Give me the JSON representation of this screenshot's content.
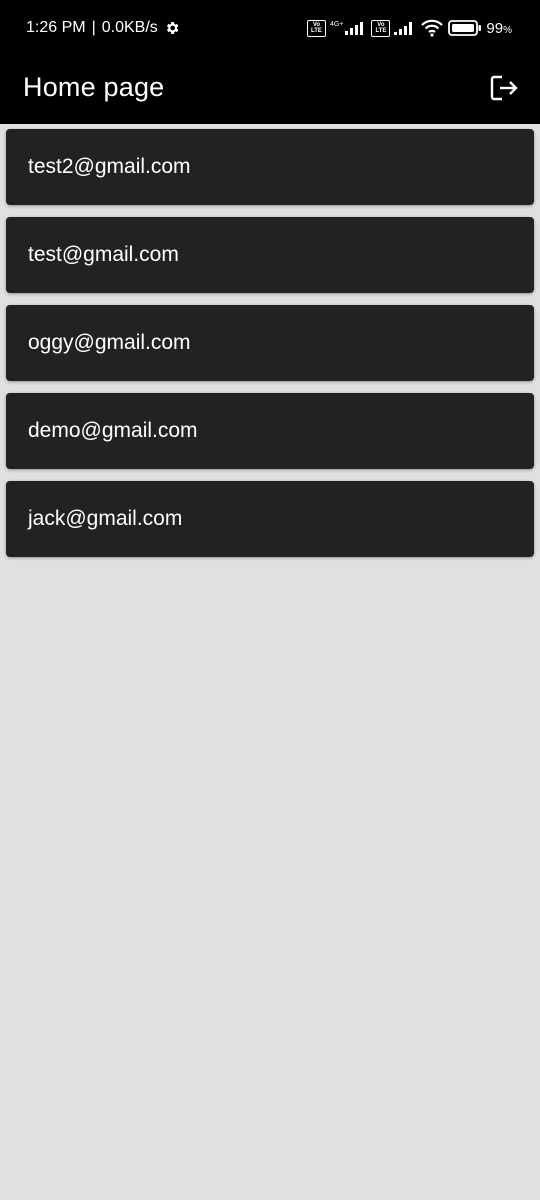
{
  "status_bar": {
    "time": "1:26 PM",
    "separator": "|",
    "net_speed": "0.0KB/s",
    "network_type": "4G+",
    "volte_label_top": "Vo",
    "volte_label_bottom": "LTE",
    "battery": "99",
    "battery_unit": "%"
  },
  "app_bar": {
    "title": "Home page",
    "logout_icon": "logout-icon"
  },
  "users": [
    {
      "email": "test2@gmail.com"
    },
    {
      "email": "test@gmail.com"
    },
    {
      "email": "oggy@gmail.com"
    },
    {
      "email": "demo@gmail.com"
    },
    {
      "email": "jack@gmail.com"
    }
  ],
  "colors": {
    "app_bar_bg": "#000000",
    "background": "#e0e0e0",
    "card_bg": "#222222",
    "text": "#ffffff"
  }
}
